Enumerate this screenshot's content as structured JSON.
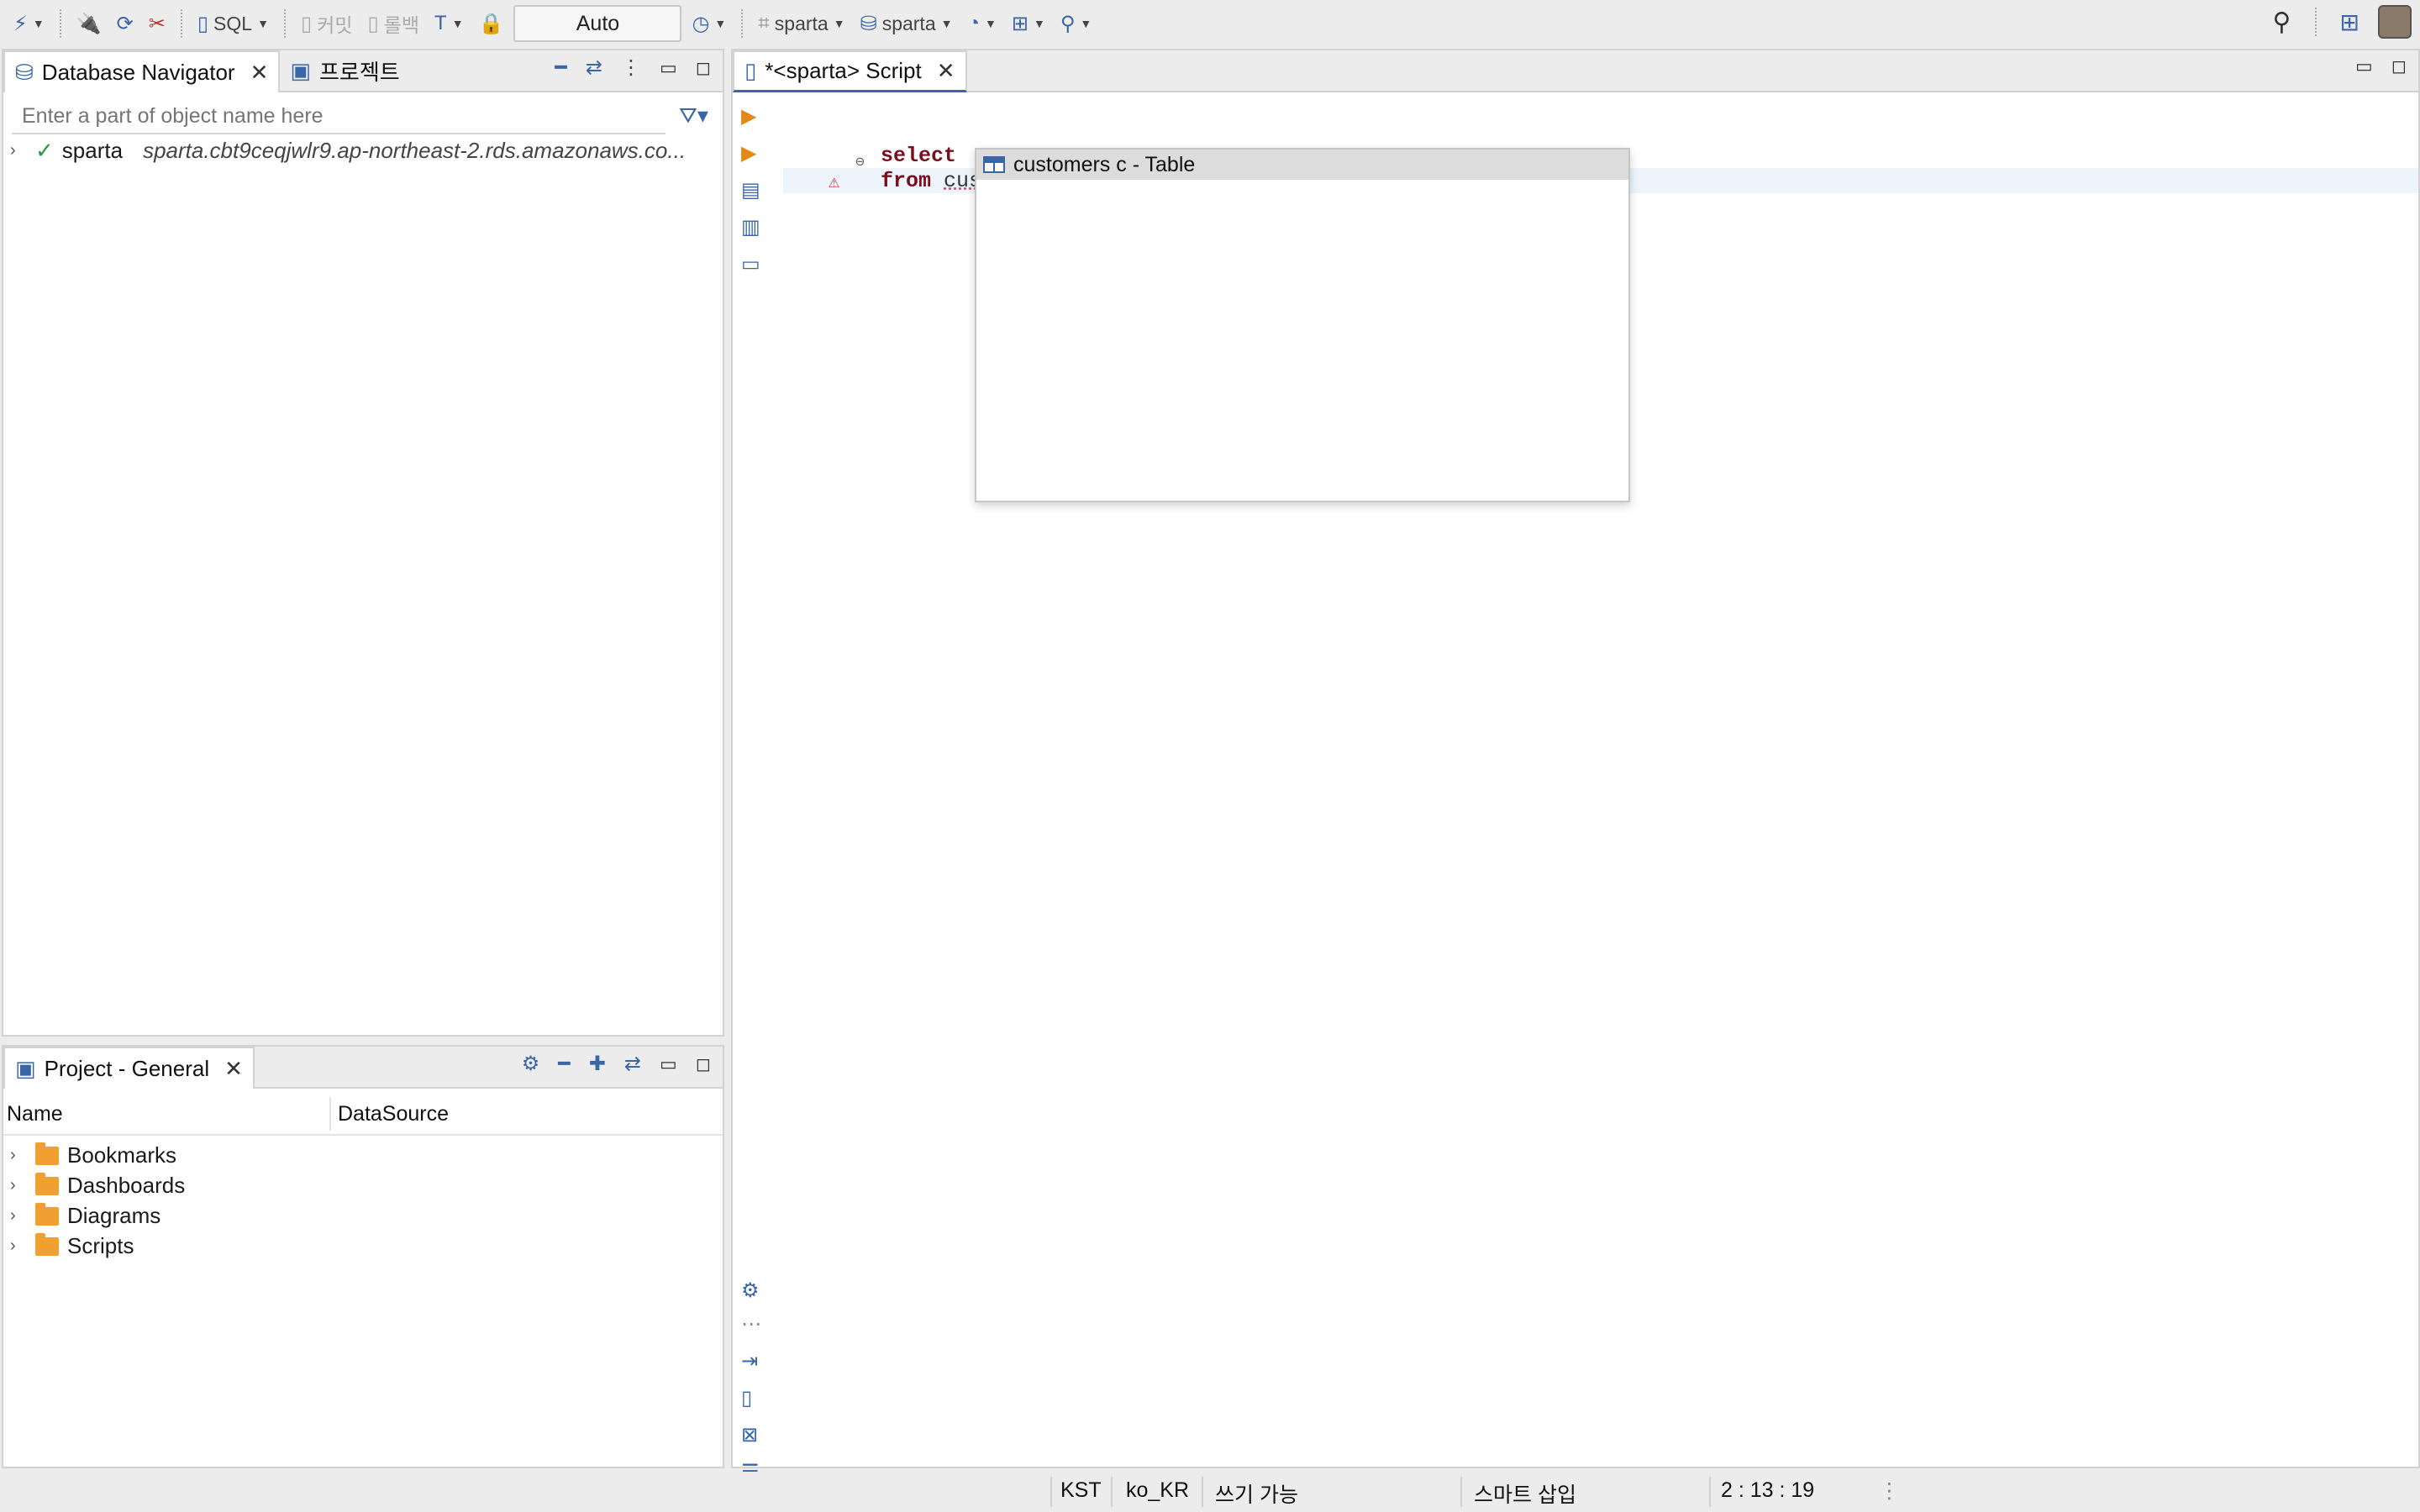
{
  "toolbar": {
    "sql_label": "SQL",
    "commit_label": "커밋",
    "rollback_label": "롤백",
    "transaction_mode": "Auto",
    "datasource_label": "sparta",
    "schema_label": "sparta"
  },
  "navigator": {
    "tab_label": "Database Navigator",
    "projects_tab_label": "프로젝트",
    "filter_placeholder": "Enter a part of object name here",
    "connection": {
      "name": "sparta",
      "url": "sparta.cbt9ceqjwlr9.ap-northeast-2.rds.amazonaws.co..."
    }
  },
  "project": {
    "tab_label": "Project - General",
    "columns": [
      "Name",
      "DataSource"
    ],
    "items": [
      {
        "label": "Bookmarks",
        "icon": "bookmarks-folder-icon"
      },
      {
        "label": "Dashboards",
        "icon": "dashboards-folder-icon"
      },
      {
        "label": "Diagrams",
        "icon": "diagrams-folder-icon"
      },
      {
        "label": "Scripts",
        "icon": "scripts-folder-icon"
      }
    ]
  },
  "editor": {
    "tab_label": "*<sparta> Script",
    "lines": [
      {
        "keyword": "select",
        "rest": ""
      },
      {
        "keyword": "from",
        "rest": "custome"
      }
    ],
    "autocomplete": {
      "items": [
        "customers c - Table"
      ]
    }
  },
  "status_bar": {
    "timezone": "KST",
    "locale": "ko_KR",
    "write_mode": "쓰기 가능",
    "insert_mode": "스마트 삽입",
    "position": "2 : 13 : 19"
  },
  "colors": {
    "accent": "#3a66a8",
    "keyword": "#7a0e1e",
    "folder": "#f0a030"
  }
}
